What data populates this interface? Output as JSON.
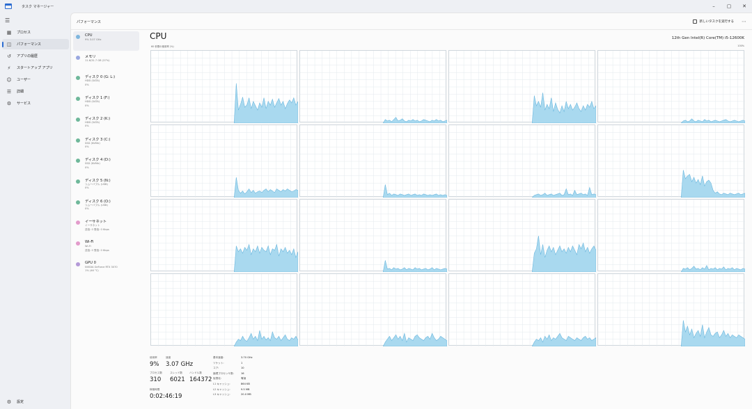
{
  "window": {
    "title": "タスク マネージャー",
    "controls": [
      "–",
      "▢",
      "✕"
    ]
  },
  "nav": {
    "items": [
      {
        "label": "プロセス",
        "icon": "grid-icon",
        "glyph": "▦"
      },
      {
        "label": "パフォーマンス",
        "icon": "performance-icon",
        "glyph": "◫",
        "active": true
      },
      {
        "label": "アプリの履歴",
        "icon": "history-icon",
        "glyph": "↺"
      },
      {
        "label": "スタートアップ アプリ",
        "icon": "startup-icon",
        "glyph": "⚡"
      },
      {
        "label": "ユーザー",
        "icon": "users-icon",
        "glyph": "☺"
      },
      {
        "label": "詳細",
        "icon": "details-icon",
        "glyph": "☰"
      },
      {
        "label": "サービス",
        "icon": "services-icon",
        "glyph": "⚙"
      }
    ],
    "settings": {
      "label": "設定",
      "glyph": "⚙"
    }
  },
  "header": {
    "title": "パフォーマンス",
    "new_task": "新しいタスクを実行する",
    "more": "⋯"
  },
  "devices": [
    {
      "name": "CPU",
      "lines": [
        "9%  3.07 GHz"
      ],
      "color": "#7fb6dd",
      "active": true
    },
    {
      "name": "メモリ",
      "lines": [
        "11.6/31.7 GB (37%)"
      ],
      "color": "#9aa8e0"
    },
    {
      "name": "ディスク 0 (G: L:)",
      "lines": [
        "HDD (SATA)",
        "0%"
      ],
      "color": "#6fb89a"
    },
    {
      "name": "ディスク 1 (F:)",
      "lines": [
        "HDD (SATA)",
        "0%"
      ],
      "color": "#6fb89a"
    },
    {
      "name": "ディスク 2 (K:)",
      "lines": [
        "HDD (SATA)",
        "0%"
      ],
      "color": "#6fb89a"
    },
    {
      "name": "ディスク 3 (C:)",
      "lines": [
        "SSD (NVMe)",
        "0%"
      ],
      "color": "#6fb89a"
    },
    {
      "name": "ディスク 4 (D:)",
      "lines": [
        "SSD (NVMe)",
        "0%"
      ],
      "color": "#6fb89a"
    },
    {
      "name": "ディスク 5 (N:)",
      "lines": [
        "リムーバブル (USB)",
        "0%"
      ],
      "color": "#6fb89a"
    },
    {
      "name": "ディスク 6 (O:)",
      "lines": [
        "リムーバブル (USB)",
        "0%"
      ],
      "color": "#6fb89a"
    },
    {
      "name": "イーサネット",
      "lines": [
        "イーサネット",
        "送信: 0  受信: 0 Kbps"
      ],
      "color": "#e39ccb"
    },
    {
      "name": "Wi-Fi",
      "lines": [
        "Wi-Fi",
        "送信: 0  受信: 0 Kbps"
      ],
      "color": "#e39ccb"
    },
    {
      "name": "GPU 0",
      "lines": [
        "NVIDIA GeForce RTX 3070",
        "1% (46 °C)"
      ],
      "color": "#b59ad8"
    }
  ],
  "cpu": {
    "title": "CPU",
    "model": "12th Gen Intel(R) Core(TM) i5-12600K",
    "util_label": "60 秒間の使用率 (%)",
    "util_max": "100%",
    "graph_color": "#a9d9ef",
    "graph_line": "#6bb7de",
    "graph_grid": "#e3e9ee",
    "cores": [
      {
        "level": "high",
        "values": [
          0,
          0,
          0,
          0,
          0,
          0,
          0,
          0,
          0,
          0,
          0,
          0,
          0,
          0,
          0,
          0,
          0,
          0,
          0,
          0,
          0,
          0,
          0,
          0,
          0,
          0,
          0,
          0,
          0,
          0,
          0,
          0,
          0,
          0,
          0,
          0,
          0,
          0,
          0,
          0,
          55,
          18,
          26,
          36,
          22,
          25,
          35,
          20,
          30,
          24,
          18,
          28,
          22,
          35,
          20,
          30,
          25,
          33,
          22,
          28,
          34,
          25,
          30,
          20,
          27,
          32,
          28,
          35,
          25,
          30
        ]
      },
      {
        "level": "low",
        "values": [
          0,
          0,
          0,
          0,
          0,
          0,
          0,
          0,
          0,
          0,
          0,
          0,
          0,
          0,
          0,
          0,
          0,
          0,
          0,
          0,
          0,
          0,
          0,
          0,
          0,
          0,
          0,
          0,
          0,
          0,
          0,
          0,
          0,
          0,
          0,
          0,
          0,
          0,
          0,
          0,
          5,
          3,
          4,
          2,
          5,
          8,
          3,
          4,
          6,
          3,
          2,
          4,
          3,
          5,
          3,
          4,
          2,
          3,
          5,
          4,
          3,
          2,
          4,
          3,
          5,
          3,
          4,
          2,
          3,
          4
        ]
      },
      {
        "level": "high",
        "values": [
          0,
          0,
          0,
          0,
          0,
          0,
          0,
          0,
          0,
          0,
          0,
          0,
          0,
          0,
          0,
          0,
          0,
          0,
          0,
          0,
          0,
          0,
          0,
          0,
          0,
          0,
          0,
          0,
          0,
          0,
          0,
          0,
          0,
          0,
          0,
          0,
          0,
          0,
          0,
          0,
          38,
          24,
          30,
          22,
          42,
          18,
          26,
          20,
          35,
          16,
          28,
          19,
          14,
          24,
          16,
          30,
          20,
          26,
          18,
          22,
          28,
          20,
          16,
          24,
          18,
          26,
          22,
          30,
          20,
          24
        ]
      },
      {
        "level": "low",
        "values": [
          0,
          0,
          0,
          0,
          0,
          0,
          0,
          0,
          0,
          0,
          0,
          0,
          0,
          0,
          0,
          0,
          0,
          0,
          0,
          0,
          0,
          0,
          0,
          0,
          0,
          0,
          0,
          0,
          0,
          0,
          0,
          0,
          0,
          0,
          0,
          0,
          0,
          0,
          0,
          0,
          3,
          4,
          2,
          3,
          6,
          3,
          2,
          4,
          3,
          2,
          5,
          3,
          4,
          2,
          3,
          4,
          3,
          2,
          3,
          4,
          5,
          3,
          2,
          3,
          4,
          3,
          2,
          3,
          4,
          3
        ]
      },
      {
        "level": "mid",
        "values": [
          0,
          0,
          0,
          0,
          0,
          0,
          0,
          0,
          0,
          0,
          0,
          0,
          0,
          0,
          0,
          0,
          0,
          0,
          0,
          0,
          0,
          0,
          0,
          0,
          0,
          0,
          0,
          0,
          0,
          0,
          0,
          0,
          0,
          0,
          0,
          0,
          0,
          0,
          0,
          0,
          28,
          10,
          6,
          9,
          5,
          8,
          12,
          7,
          10,
          6,
          8,
          9,
          7,
          10,
          12,
          8,
          11,
          9,
          7,
          12,
          10,
          8,
          11,
          9,
          12,
          10,
          8,
          9,
          11,
          10
        ]
      },
      {
        "level": "low",
        "values": [
          0,
          0,
          0,
          0,
          0,
          0,
          0,
          0,
          0,
          0,
          0,
          0,
          0,
          0,
          0,
          0,
          0,
          0,
          0,
          0,
          0,
          0,
          0,
          0,
          0,
          0,
          0,
          0,
          0,
          0,
          0,
          0,
          0,
          0,
          0,
          0,
          0,
          0,
          0,
          0,
          18,
          4,
          6,
          3,
          5,
          4,
          3,
          5,
          4,
          3,
          4,
          5,
          3,
          4,
          5,
          3,
          4,
          3,
          5,
          4,
          3,
          4,
          3,
          4,
          5,
          3,
          4,
          3,
          4,
          3
        ]
      },
      {
        "level": "low",
        "values": [
          0,
          0,
          0,
          0,
          0,
          0,
          0,
          0,
          0,
          0,
          0,
          0,
          0,
          0,
          0,
          0,
          0,
          0,
          0,
          0,
          0,
          0,
          0,
          0,
          0,
          0,
          0,
          0,
          0,
          0,
          0,
          0,
          0,
          0,
          0,
          0,
          0,
          0,
          0,
          0,
          3,
          4,
          5,
          3,
          4,
          6,
          3,
          4,
          5,
          3,
          4,
          5,
          6,
          3,
          4,
          12,
          4,
          5,
          3,
          10,
          4,
          5,
          6,
          4,
          5,
          3,
          14,
          4,
          5,
          4
        ]
      },
      {
        "level": "mid",
        "values": [
          0,
          0,
          0,
          0,
          0,
          0,
          0,
          0,
          0,
          0,
          0,
          0,
          0,
          0,
          0,
          0,
          0,
          0,
          0,
          0,
          0,
          0,
          0,
          0,
          0,
          0,
          0,
          0,
          0,
          0,
          0,
          0,
          0,
          0,
          0,
          0,
          0,
          0,
          0,
          0,
          38,
          26,
          30,
          32,
          22,
          28,
          20,
          25,
          18,
          30,
          16,
          22,
          24,
          20,
          10,
          6,
          8,
          5,
          4,
          6,
          5,
          4,
          6,
          5,
          4,
          5,
          6,
          4,
          5,
          6
        ]
      },
      {
        "level": "high",
        "values": [
          0,
          0,
          0,
          0,
          0,
          0,
          0,
          0,
          0,
          0,
          0,
          0,
          0,
          0,
          0,
          0,
          0,
          0,
          0,
          0,
          0,
          0,
          0,
          0,
          0,
          0,
          0,
          0,
          0,
          0,
          0,
          0,
          0,
          0,
          0,
          0,
          0,
          0,
          0,
          0,
          36,
          28,
          32,
          26,
          34,
          30,
          38,
          24,
          32,
          28,
          36,
          26,
          34,
          30,
          28,
          36,
          24,
          32,
          30,
          38,
          22,
          32,
          28,
          34,
          26,
          30,
          24,
          32,
          20,
          28
        ]
      },
      {
        "level": "low",
        "values": [
          0,
          0,
          0,
          0,
          0,
          0,
          0,
          0,
          0,
          0,
          0,
          0,
          0,
          0,
          0,
          0,
          0,
          0,
          0,
          0,
          0,
          0,
          0,
          0,
          0,
          0,
          0,
          0,
          0,
          0,
          0,
          0,
          0,
          0,
          0,
          0,
          0,
          0,
          0,
          0,
          16,
          4,
          5,
          3,
          6,
          4,
          5,
          3,
          4,
          6,
          3,
          5,
          4,
          3,
          6,
          4,
          5,
          3,
          4,
          5,
          3,
          4,
          6,
          3,
          5,
          4,
          3,
          4,
          5,
          4
        ]
      },
      {
        "level": "high",
        "values": [
          0,
          0,
          0,
          0,
          0,
          0,
          0,
          0,
          0,
          0,
          0,
          0,
          0,
          0,
          0,
          0,
          0,
          0,
          0,
          0,
          0,
          0,
          0,
          0,
          0,
          0,
          0,
          0,
          0,
          0,
          0,
          0,
          0,
          0,
          0,
          0,
          0,
          0,
          0,
          0,
          26,
          32,
          50,
          24,
          38,
          20,
          30,
          36,
          28,
          34,
          24,
          30,
          36,
          28,
          32,
          26,
          34,
          28,
          36,
          30,
          24,
          38,
          32,
          40,
          28,
          34,
          26,
          32,
          36,
          30
        ]
      },
      {
        "level": "low",
        "values": [
          0,
          0,
          0,
          0,
          0,
          0,
          0,
          0,
          0,
          0,
          0,
          0,
          0,
          0,
          0,
          0,
          0,
          0,
          0,
          0,
          0,
          0,
          0,
          0,
          0,
          0,
          0,
          0,
          0,
          0,
          0,
          0,
          0,
          0,
          0,
          0,
          0,
          0,
          0,
          0,
          5,
          4,
          6,
          3,
          5,
          8,
          4,
          5,
          3,
          6,
          4,
          9,
          3,
          5,
          4,
          6,
          3,
          5,
          4,
          7,
          3,
          5,
          4,
          6,
          3,
          5,
          4,
          3,
          5,
          4
        ]
      },
      {
        "level": "mid",
        "values": [
          0,
          0,
          0,
          0,
          0,
          0,
          0,
          0,
          0,
          0,
          0,
          0,
          0,
          0,
          0,
          0,
          0,
          0,
          0,
          0,
          0,
          0,
          0,
          0,
          0,
          0,
          0,
          0,
          0,
          0,
          0,
          0,
          0,
          0,
          0,
          0,
          0,
          0,
          0,
          0,
          6,
          10,
          8,
          14,
          9,
          7,
          12,
          18,
          10,
          14,
          8,
          22,
          10,
          14,
          9,
          12,
          8,
          20,
          12,
          10,
          14,
          8,
          12,
          16,
          10,
          8,
          12,
          10,
          14,
          9
        ]
      },
      {
        "level": "mid",
        "values": [
          0,
          0,
          0,
          0,
          0,
          0,
          0,
          0,
          0,
          0,
          0,
          0,
          0,
          0,
          0,
          0,
          0,
          0,
          0,
          0,
          0,
          0,
          0,
          0,
          0,
          0,
          0,
          0,
          0,
          0,
          0,
          0,
          0,
          0,
          0,
          0,
          0,
          0,
          0,
          0,
          6,
          10,
          14,
          8,
          12,
          16,
          10,
          14,
          8,
          18,
          6,
          12,
          10,
          8,
          14,
          16,
          12,
          10,
          8,
          12,
          14,
          10,
          18,
          12,
          8,
          10,
          14,
          12,
          10,
          8
        ]
      },
      {
        "level": "mid",
        "values": [
          0,
          0,
          0,
          0,
          0,
          0,
          0,
          0,
          0,
          0,
          0,
          0,
          0,
          0,
          0,
          0,
          0,
          0,
          0,
          0,
          0,
          0,
          0,
          0,
          0,
          0,
          0,
          0,
          0,
          0,
          0,
          0,
          0,
          0,
          0,
          0,
          0,
          0,
          0,
          0,
          6,
          10,
          8,
          12,
          6,
          14,
          10,
          16,
          8,
          12,
          10,
          14,
          18,
          12,
          10,
          8,
          14,
          12,
          10,
          8,
          12,
          10,
          8,
          12,
          14,
          10,
          12,
          8,
          10,
          12
        ]
      },
      {
        "level": "mid",
        "values": [
          0,
          0,
          0,
          0,
          0,
          0,
          0,
          0,
          0,
          0,
          0,
          0,
          0,
          0,
          0,
          0,
          0,
          0,
          0,
          0,
          0,
          0,
          0,
          0,
          0,
          0,
          0,
          0,
          0,
          0,
          0,
          0,
          0,
          0,
          0,
          0,
          0,
          0,
          0,
          0,
          36,
          20,
          28,
          16,
          24,
          12,
          18,
          22,
          14,
          30,
          12,
          20,
          26,
          16,
          14,
          18,
          20,
          12,
          16,
          22,
          14,
          18,
          12,
          16,
          14,
          12,
          16,
          14,
          12,
          10
        ]
      }
    ]
  },
  "stats": {
    "utilization": {
      "label": "使用率",
      "value": "9%"
    },
    "speed": {
      "label": "速度",
      "value": "3.07 GHz"
    },
    "processes": {
      "label": "プロセス数",
      "value": "310"
    },
    "threads": {
      "label": "スレッド数",
      "value": "6021"
    },
    "handles": {
      "label": "ハンドル数",
      "value": "164372"
    },
    "uptime": {
      "label": "稼働時間",
      "value": "0:02:46:19"
    }
  },
  "specs": [
    {
      "label": "基本速度:",
      "value": "3.70 GHz"
    },
    {
      "label": "ソケット:",
      "value": "1"
    },
    {
      "label": "コア:",
      "value": "10"
    },
    {
      "label": "論理プロセッサ数:",
      "value": "16"
    },
    {
      "label": "仮想化:",
      "value": "有効"
    },
    {
      "label": "L1 キャッシュ:",
      "value": "864 KB"
    },
    {
      "label": "L2 キャッシュ:",
      "value": "9.5 MB"
    },
    {
      "label": "L3 キャッシュ:",
      "value": "20.0 MB"
    }
  ]
}
